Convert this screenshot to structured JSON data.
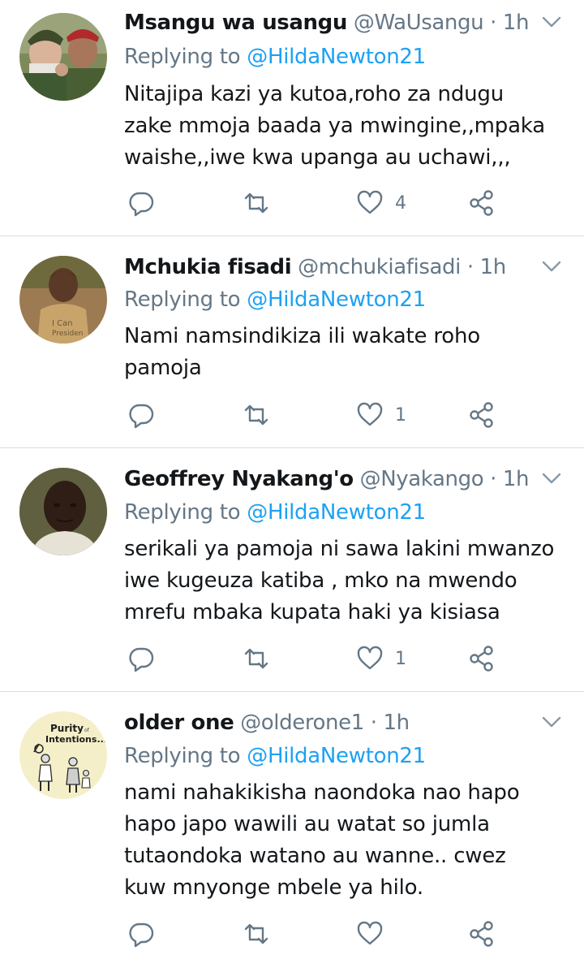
{
  "tweets": [
    {
      "name": "Msangu wa usangu",
      "handle": "@WaUsangu",
      "separator": "·",
      "time": "1h",
      "replying_label": "Replying to",
      "replying_to": "@HildaNewton21",
      "text": "Nitajipa kazi ya kutoa,roho za ndugu\nzake mmoja baada ya mwingine,,mpaka\nwaishe,,iwe kwa upanga au uchawi,,,",
      "like_count": "4",
      "avatar_icon": "avatar-two-soldiers"
    },
    {
      "name": "Mchukia fisadi",
      "handle": "@mchukiafisadi",
      "separator": "·",
      "time": "1h",
      "replying_label": "Replying to",
      "replying_to": "@HildaNewton21",
      "text": "Nami namsindikiza ili wakate roho\npamoja",
      "like_count": "1",
      "avatar_icon": "avatar-child"
    },
    {
      "name": "Geoffrey Nyakang'o",
      "handle": "@Nyakango",
      "separator": "·",
      "time": "1h",
      "replying_label": "Replying to",
      "replying_to": "@HildaNewton21",
      "text": "serikali ya pamoja ni sawa lakini mwanzo\niwe kugeuza katiba , mko na mwendo\nmrefu mbaka kupata haki ya kisiasa",
      "like_count": "1",
      "avatar_icon": "avatar-man"
    },
    {
      "name": "older one",
      "handle": "@olderone1",
      "separator": "·",
      "time": "1h",
      "replying_label": "Replying to",
      "replying_to": "@HildaNewton21",
      "text": "nami nahakikisha naondoka nao hapo\nhapo japo wawili au watat so jumla\ntutaondoka watano au wanne.. cwez\nkuw mnyonge mbele ya hilo.",
      "like_count": "",
      "avatar_icon": "avatar-cartoon",
      "avatar_text": {
        "line1": "Purity",
        "small": "of",
        "line2": "Intentions..."
      }
    }
  ],
  "icons": {
    "reply": "reply-icon",
    "retweet": "retweet-icon",
    "like": "heart-icon",
    "share": "share-icon",
    "menu": "chevron-down-icon"
  },
  "colors": {
    "text": "#14171a",
    "secondary": "#657786",
    "link": "#1da1f2",
    "divider": "#d8dde2"
  }
}
